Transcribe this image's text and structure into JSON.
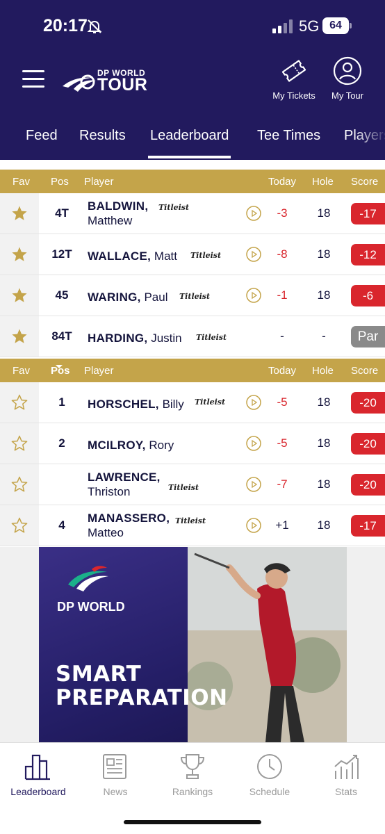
{
  "status_bar": {
    "time": "20:17",
    "network": "5G",
    "battery": "64",
    "icons": [
      "bell-muted-icon",
      "signal-icon"
    ]
  },
  "header": {
    "logo_top": "DP WORLD",
    "logo_bottom": "TOUR",
    "actions": [
      {
        "label": "My Tickets",
        "icon": "ticket-icon"
      },
      {
        "label": "My Tour",
        "icon": "user-icon"
      }
    ],
    "menu_icon": "menu-icon"
  },
  "nav_tabs": [
    {
      "label": "Feed",
      "active": false
    },
    {
      "label": "Results",
      "active": false
    },
    {
      "label": "Leaderboard",
      "active": true
    },
    {
      "label": "Tee Times",
      "active": false
    },
    {
      "label": "Players",
      "active": false
    }
  ],
  "columns": {
    "fav": "Fav",
    "pos": "Pos",
    "player": "Player",
    "today": "Today",
    "hole": "Hole",
    "score": "Score"
  },
  "favorites": [
    {
      "pos": "4T",
      "last": "BALDWIN,",
      "first": "Matthew",
      "sponsor": "Titleist",
      "today": "-3",
      "hole": "18",
      "score": "-17",
      "favorited": true
    },
    {
      "pos": "12T",
      "last": "WALLACE,",
      "first": "Matt",
      "sponsor": "Titleist",
      "today": "-8",
      "hole": "18",
      "score": "-12",
      "favorited": true
    },
    {
      "pos": "45",
      "last": "WARING,",
      "first": "Paul",
      "sponsor": "Titleist",
      "today": "-1",
      "hole": "18",
      "score": "-6",
      "favorited": true
    },
    {
      "pos": "84T",
      "last": "HARDING,",
      "first": "Justin",
      "sponsor": "Titleist",
      "today": "-",
      "hole": "-",
      "score": "Par",
      "favorited": true
    }
  ],
  "leaderboard": [
    {
      "pos": "1",
      "last": "HORSCHEL,",
      "first": "Billy",
      "sponsor": "Titleist",
      "today": "-5",
      "hole": "18",
      "score": "-20",
      "favorited": false
    },
    {
      "pos": "2",
      "last": "MCILROY,",
      "first": "Rory",
      "sponsor": "",
      "today": "-5",
      "hole": "18",
      "score": "-20",
      "favorited": false
    },
    {
      "pos": "",
      "last": "LAWRENCE,",
      "first": "Thriston",
      "sponsor": "Titleist",
      "today": "-7",
      "hole": "18",
      "score": "-20",
      "favorited": false
    },
    {
      "pos": "4",
      "last": "MANASSERO,",
      "first": "Matteo",
      "sponsor": "Titleist",
      "today": "+1",
      "hole": "18",
      "score": "-17",
      "favorited": false
    }
  ],
  "ad": {
    "brand": "DP WORLD",
    "headline_line1": "SMART",
    "headline_line2": "PREPARATION"
  },
  "bottom_tabs": [
    {
      "label": "Leaderboard",
      "icon": "leaderboard-icon",
      "active": true
    },
    {
      "label": "News",
      "icon": "news-icon",
      "active": false
    },
    {
      "label": "Rankings",
      "icon": "trophy-icon",
      "active": false
    },
    {
      "label": "Schedule",
      "icon": "clock-icon",
      "active": false
    },
    {
      "label": "Stats",
      "icon": "stats-icon",
      "active": false
    }
  ],
  "colors": {
    "header_bg": "#221a5e",
    "gold": "#c4a44a",
    "score_red": "#d9262d",
    "par_grey": "#8a8a8a"
  }
}
